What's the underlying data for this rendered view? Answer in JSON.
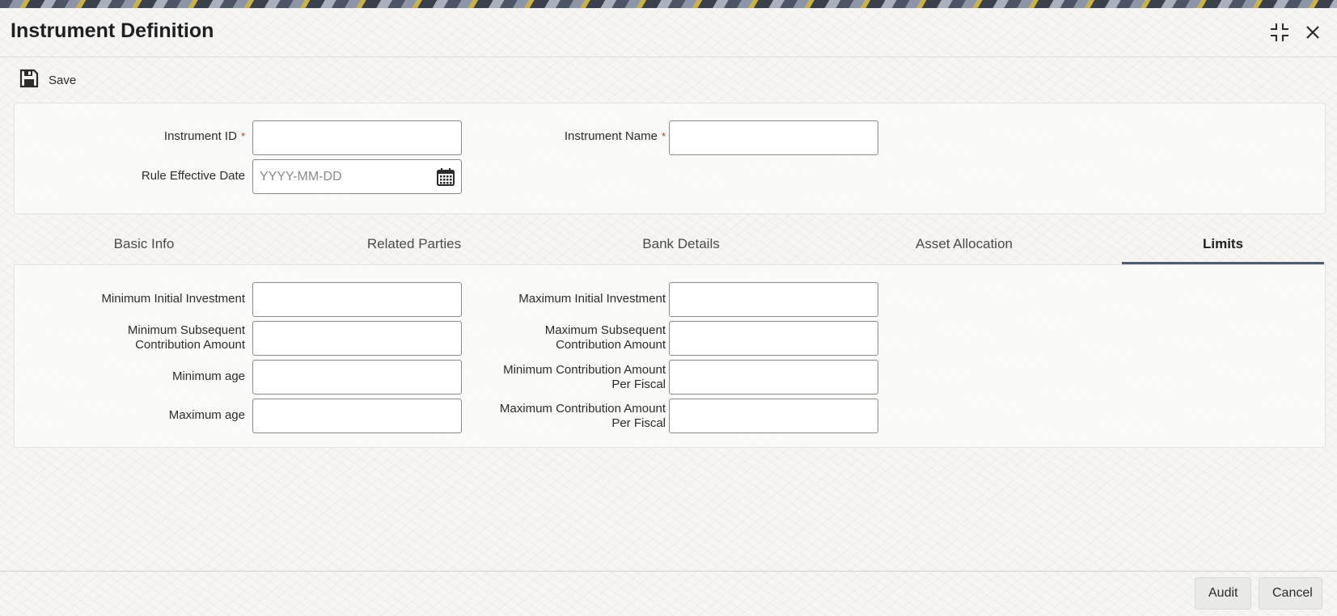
{
  "header": {
    "title": "Instrument Definition",
    "maximize_icon": "maximize-icon",
    "close_icon": "close-icon"
  },
  "toolbar": {
    "save_label": "Save",
    "save_icon": "floppy-disk-icon"
  },
  "form": {
    "instrument_id": {
      "label": "Instrument ID",
      "required_mark": "*",
      "value": ""
    },
    "instrument_name": {
      "label": "Instrument Name",
      "required_mark": "*",
      "value": ""
    },
    "rule_effective_date": {
      "label": "Rule Effective Date",
      "value": "",
      "placeholder": "YYYY-MM-DD",
      "icon": "calendar-icon"
    }
  },
  "tabs": [
    {
      "label": "Basic Info",
      "active": false
    },
    {
      "label": "Related Parties",
      "active": false
    },
    {
      "label": "Bank Details",
      "active": false
    },
    {
      "label": "Asset Allocation",
      "active": false
    },
    {
      "label": "Limits",
      "active": true
    }
  ],
  "limits": {
    "min_initial_investment": {
      "label": "Minimum Initial Investment",
      "value": ""
    },
    "max_initial_investment": {
      "label": "Maximum Initial Investment",
      "value": ""
    },
    "min_subsequent_contribution": {
      "label_line1": "Minimum Subsequent",
      "label_line2": "Contribution Amount",
      "value": ""
    },
    "max_subsequent_contribution": {
      "label_line1": "Maximum Subsequent",
      "label_line2": "Contribution Amount",
      "value": ""
    },
    "min_age": {
      "label": "Minimum age",
      "value": ""
    },
    "min_contribution_per_fiscal": {
      "label_line1": "Minimum Contribution Amount",
      "label_line2": "Per Fiscal",
      "value": ""
    },
    "max_age": {
      "label": "Maximum age",
      "value": ""
    },
    "max_contribution_per_fiscal": {
      "label_line1": "Maximum Contribution Amount",
      "label_line2": "Per Fiscal",
      "value": ""
    }
  },
  "footer": {
    "audit_label": "Audit",
    "cancel_label": "Cancel"
  },
  "colors": {
    "required": "#c0392b",
    "active_tab_underline": "#505a70",
    "field_border": "#8a8a8a"
  }
}
